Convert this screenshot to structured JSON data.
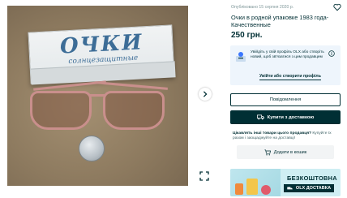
{
  "listing": {
    "date": "Опубліковано 15 серпня 2020 р.",
    "title": "Очки в родной упаковке 1983 года- Качественные",
    "price": "250 грн.",
    "photo": {
      "box_title": "ОЧКИ",
      "box_subtitle": "солнцезащитные"
    }
  },
  "promo": {
    "text": "Увійдіть у свій профіль OLX або створіть новий, щоб зв'язатися з цим продавцем",
    "link": "Увійти або створити профіль"
  },
  "actions": {
    "message": "Повідомлення",
    "buy": "Купити з доставкою"
  },
  "delivery": {
    "question": "Цікавлять інші товари цього продавця?",
    "hint": "Купуйте їх разом і заощаджуйте на доставці!",
    "cart": "Додати в кошик"
  },
  "banner": {
    "headline": "БЕЗКОШТОВНА",
    "bar": "OLX ДОСТАВКА"
  },
  "icons": {
    "favorite": "heart-icon",
    "next": "chevron-right-icon",
    "fullscreen": "expand-icon",
    "info": "info-icon",
    "truck": "truck-icon",
    "cart": "cart-icon"
  },
  "colors": {
    "primary": "#002f34",
    "promo_bg": "#eef5fc",
    "banner_bg": "#cfeef3"
  }
}
